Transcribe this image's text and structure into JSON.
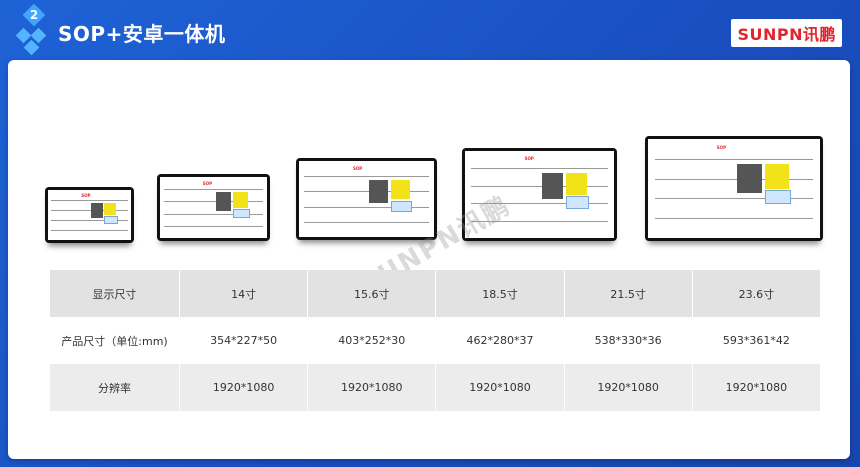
{
  "header": {
    "badge": "2",
    "title": "SOP+安卓一体机",
    "logo": "SUNPN讯鹏"
  },
  "watermark": "SUNPN讯鹏",
  "devices": [
    {
      "name": "14寸",
      "stamp": "SOP"
    },
    {
      "name": "15.6寸",
      "stamp": "SOP"
    },
    {
      "name": "18.5寸",
      "stamp": "SOP"
    },
    {
      "name": "21.5寸",
      "stamp": "SOP"
    },
    {
      "name": "23.6寸",
      "stamp": "SOP"
    }
  ],
  "table": {
    "rows": [
      [
        "显示尺寸",
        "14寸",
        "15.6寸",
        "18.5寸",
        "21.5寸",
        "23.6寸"
      ],
      [
        "产品尺寸（单位:mm)",
        "354*227*50",
        "403*252*30",
        "462*280*37",
        "538*330*36",
        "593*361*42"
      ],
      [
        "分辨率",
        "1920*1080",
        "1920*1080",
        "1920*1080",
        "1920*1080",
        "1920*1080"
      ]
    ]
  }
}
